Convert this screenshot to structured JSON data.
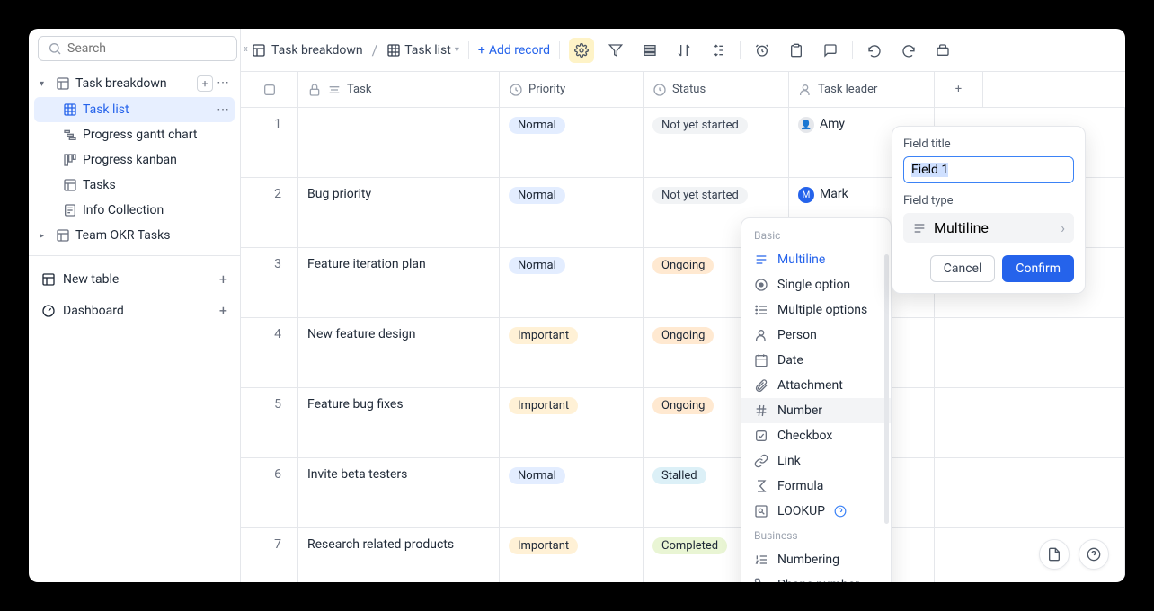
{
  "search": {
    "placeholder": "Search"
  },
  "sidebar": {
    "root": {
      "label": "Task breakdown"
    },
    "views": [
      {
        "label": "Task list",
        "active": true
      },
      {
        "label": "Progress gantt chart"
      },
      {
        "label": "Progress kanban"
      },
      {
        "label": "Tasks"
      },
      {
        "label": "Info Collection"
      }
    ],
    "sibling": {
      "label": "Team OKR Tasks"
    },
    "newTable": "New table",
    "dashboard": "Dashboard"
  },
  "toolbar": {
    "crumb1": "Task breakdown",
    "view": "Task list",
    "addRecord": "Add record"
  },
  "columns": {
    "task": "Task",
    "priority": "Priority",
    "status": "Status",
    "leader": "Task leader"
  },
  "rows": [
    {
      "num": "1",
      "task": "",
      "priority": "Normal",
      "priorityCls": "normal",
      "status": "Not yet started",
      "statusCls": "nys",
      "leader": "Amy",
      "avatarCls": "amy",
      "avatarInit": "👤"
    },
    {
      "num": "2",
      "task": "Bug priority",
      "priority": "Normal",
      "priorityCls": "normal",
      "status": "Not yet started",
      "statusCls": "nys",
      "leader": "Mark",
      "avatarCls": "mark",
      "avatarInit": "M"
    },
    {
      "num": "3",
      "task": "Feature iteration plan",
      "priority": "Normal",
      "priorityCls": "normal",
      "status": "Ongoing",
      "statusCls": "ongoing",
      "leader": ""
    },
    {
      "num": "4",
      "task": "New feature design",
      "priority": "Important",
      "priorityCls": "important",
      "status": "Ongoing",
      "statusCls": "ongoing",
      "leader": ""
    },
    {
      "num": "5",
      "task": "Feature bug fixes",
      "priority": "Important",
      "priorityCls": "important",
      "status": "Ongoing",
      "statusCls": "ongoing",
      "leader": ""
    },
    {
      "num": "6",
      "task": "Invite beta testers",
      "priority": "Normal",
      "priorityCls": "normal",
      "status": "Stalled",
      "statusCls": "stalled",
      "leader": ""
    },
    {
      "num": "7",
      "task": "Research related products",
      "priority": "Important",
      "priorityCls": "important",
      "status": "Completed",
      "statusCls": "completed",
      "leader": ""
    }
  ],
  "fieldPopup": {
    "titleLabel": "Field title",
    "titleValue": "Field 1",
    "typeLabel": "Field type",
    "selectedType": "Multiline",
    "cancel": "Cancel",
    "confirm": "Confirm"
  },
  "typeMenu": {
    "section1": "Basic",
    "items1": [
      {
        "label": "Multiline",
        "selected": true
      },
      {
        "label": "Single option"
      },
      {
        "label": "Multiple options"
      },
      {
        "label": "Person"
      },
      {
        "label": "Date"
      },
      {
        "label": "Attachment"
      },
      {
        "label": "Number",
        "hovered": true
      },
      {
        "label": "Checkbox"
      },
      {
        "label": "Link"
      },
      {
        "label": "Formula"
      },
      {
        "label": "LOOKUP",
        "help": true
      }
    ],
    "section2": "Business",
    "items2": [
      {
        "label": "Numbering"
      },
      {
        "label": "Phone number"
      }
    ]
  }
}
